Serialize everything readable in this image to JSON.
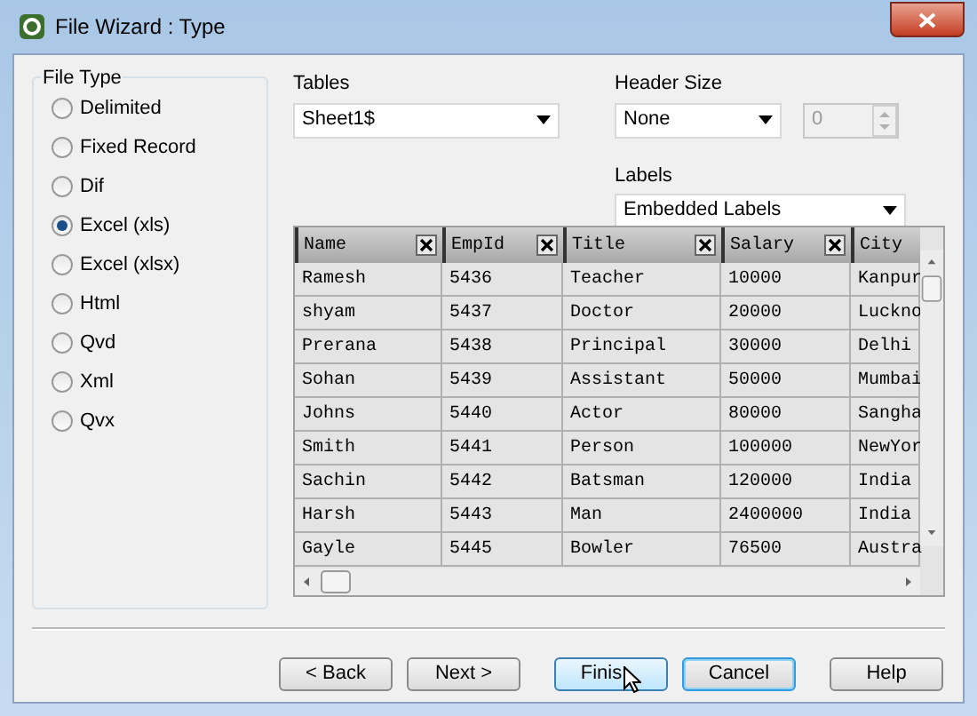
{
  "window": {
    "title": "File Wizard : Type"
  },
  "file_type": {
    "label": "File Type",
    "options": [
      {
        "label": "Delimited",
        "selected": false
      },
      {
        "label": "Fixed Record",
        "selected": false
      },
      {
        "label": "Dif",
        "selected": false
      },
      {
        "label": "Excel (xls)",
        "selected": true
      },
      {
        "label": "Excel (xlsx)",
        "selected": false
      },
      {
        "label": "Html",
        "selected": false
      },
      {
        "label": "Qvd",
        "selected": false
      },
      {
        "label": "Xml",
        "selected": false
      },
      {
        "label": "Qvx",
        "selected": false
      }
    ]
  },
  "tables": {
    "label": "Tables",
    "value": "Sheet1$"
  },
  "header_size": {
    "label": "Header Size",
    "value": "None",
    "spin_value": "0",
    "spin_disabled": true
  },
  "labels": {
    "label": "Labels",
    "value": "Embedded Labels"
  },
  "grid": {
    "columns": [
      "Name",
      "EmpId",
      "Title",
      "Salary",
      "City"
    ],
    "rows": [
      [
        "Ramesh",
        "5436",
        "Teacher",
        "10000",
        "Kanpur"
      ],
      [
        "shyam",
        "5437",
        "Doctor",
        "20000",
        "Luckno"
      ],
      [
        "Prerana",
        "5438",
        "Principal",
        "30000",
        "Delhi"
      ],
      [
        "Sohan",
        "5439",
        "Assistant",
        "50000",
        "Mumbai"
      ],
      [
        "Johns",
        "5440",
        "Actor",
        "80000",
        "Sangha"
      ],
      [
        "Smith",
        "5441",
        "Person",
        "100000",
        "NewYor"
      ],
      [
        "Sachin",
        "5442",
        "Batsman",
        "120000",
        "India"
      ],
      [
        "Harsh",
        "5443",
        "Man",
        "2400000",
        "India"
      ],
      [
        "Gayle",
        "5445",
        "Bowler",
        "76500",
        "Austra"
      ]
    ]
  },
  "buttons": [
    {
      "label": "< Back",
      "hovered": false,
      "focused": false
    },
    {
      "label": "Next >",
      "hovered": false,
      "focused": false
    },
    {
      "label": "Finis",
      "hovered": true,
      "focused": false
    },
    {
      "label": "Cancel",
      "hovered": false,
      "focused": true
    },
    {
      "label": "Help",
      "hovered": false,
      "focused": false
    }
  ]
}
